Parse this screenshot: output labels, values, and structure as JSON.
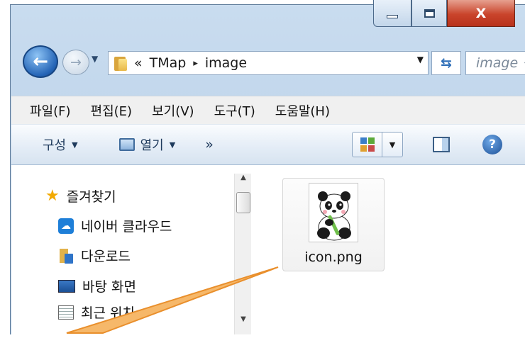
{
  "window": {
    "caption": {
      "minimize_icon": "minimize-icon",
      "maximize_icon": "maximize-icon",
      "close_glyph": "X"
    }
  },
  "nav": {
    "overflow": "«",
    "path": [
      "TMap",
      "image"
    ],
    "separator": "▸",
    "search_placeholder": "image 검"
  },
  "menu": [
    "파일(F)",
    "편집(E)",
    "보기(V)",
    "도구(T)",
    "도움말(H)"
  ],
  "toolbar": {
    "organize": "구성",
    "open": "열기",
    "more": "»"
  },
  "sidebar": {
    "favorites": "즐겨찾기",
    "items": [
      "네이버 클라우드",
      "다운로드",
      "바탕 화면",
      "최근 위치"
    ]
  },
  "files": [
    {
      "name": "icon.png"
    }
  ],
  "colors": {
    "annotation_arrow": "#f0a03c",
    "accent": "#2464b6"
  }
}
